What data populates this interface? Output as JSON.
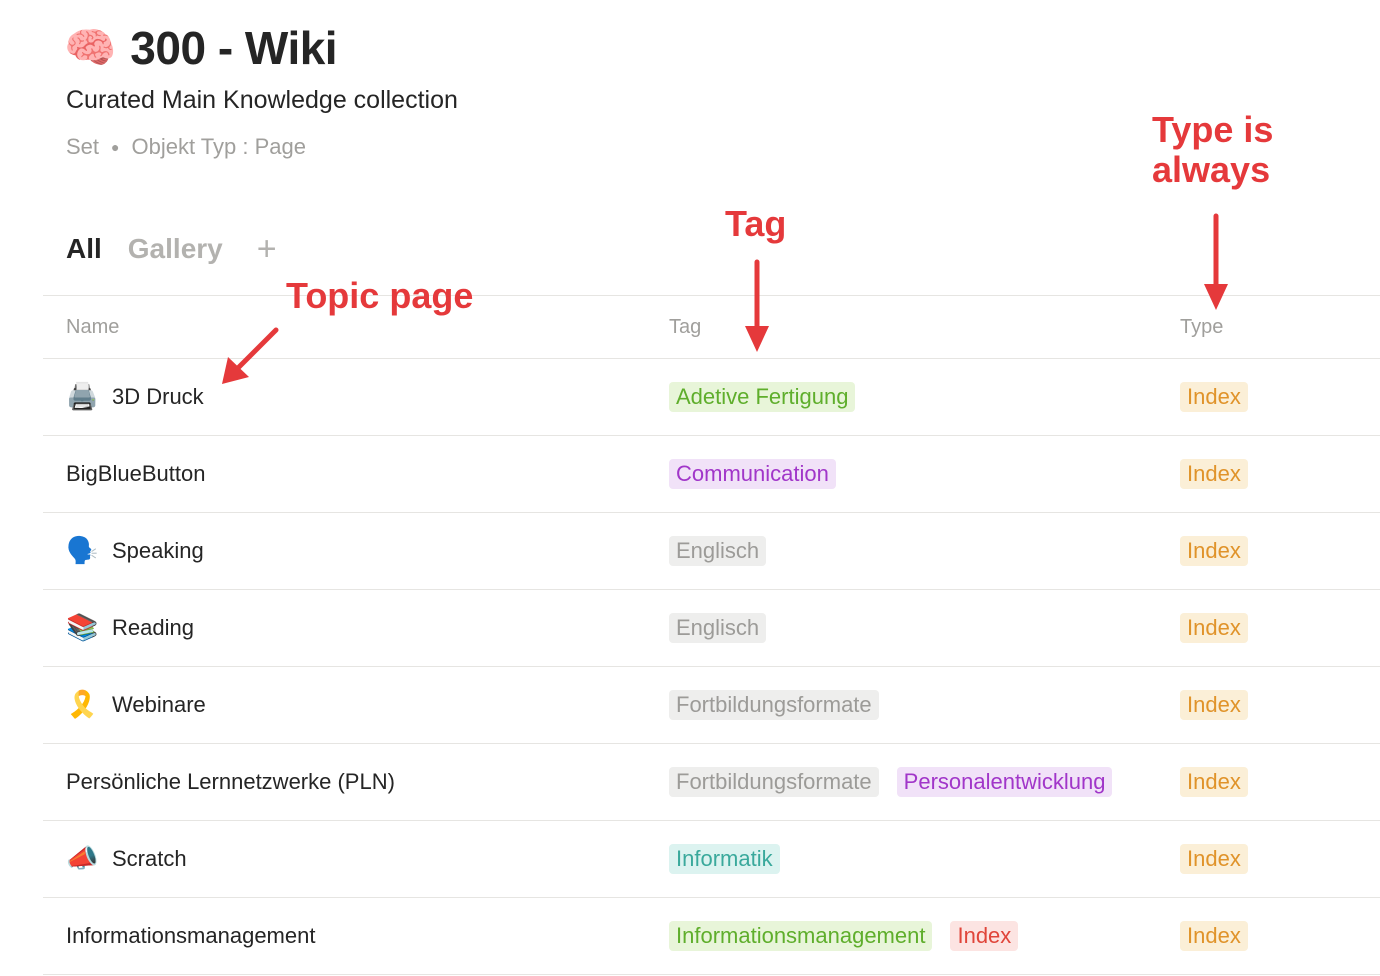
{
  "page": {
    "icon": "brain-icon",
    "icon_glyph": "🧠",
    "title": "300 - Wiki",
    "subtitle": "Curated Main Knowledge collection",
    "meta_set": "Set",
    "meta_type": "Objekt Typ : Page"
  },
  "tabs": {
    "all": "All",
    "gallery": "Gallery",
    "add": "+"
  },
  "table": {
    "headers": {
      "name": "Name",
      "tag": "Tag",
      "type": "Type"
    },
    "rows": [
      {
        "icon": "printer-icon",
        "glyph": "🖨️",
        "name": "3D Druck",
        "tags": [
          {
            "label": "Adetive Fertigung",
            "color": "#5fae2c",
            "bg": "#e8f5d9"
          }
        ],
        "type": {
          "label": "Index",
          "color": "#e0932a",
          "bg": "#fbefd7"
        }
      },
      {
        "icon": "",
        "glyph": "",
        "name": "BigBlueButton",
        "tags": [
          {
            "label": "Communication",
            "color": "#a136c9",
            "bg": "#f1e2f8"
          }
        ],
        "type": {
          "label": "Index",
          "color": "#e0932a",
          "bg": "#fbefd7"
        }
      },
      {
        "icon": "speaking-head-icon",
        "glyph": "🗣️",
        "name": "Speaking",
        "tags": [
          {
            "label": "Englisch",
            "color": "#9c9b98",
            "bg": "#eeeeed"
          }
        ],
        "type": {
          "label": "Index",
          "color": "#e0932a",
          "bg": "#fbefd7"
        }
      },
      {
        "icon": "books-icon",
        "glyph": "📚",
        "name": "Reading",
        "tags": [
          {
            "label": "Englisch",
            "color": "#9c9b98",
            "bg": "#eeeeed"
          }
        ],
        "type": {
          "label": "Index",
          "color": "#e0932a",
          "bg": "#fbefd7"
        }
      },
      {
        "icon": "ribbon-icon",
        "glyph": "🎗️",
        "name": "Webinare",
        "tags": [
          {
            "label": "Fortbildungsformate",
            "color": "#9c9b98",
            "bg": "#eeeeed"
          }
        ],
        "type": {
          "label": "Index",
          "color": "#e0932a",
          "bg": "#fbefd7"
        }
      },
      {
        "icon": "",
        "glyph": "",
        "name": "Persönliche Lernnetzwerke (PLN)",
        "tags": [
          {
            "label": "Fortbildungsformate",
            "color": "#9c9b98",
            "bg": "#eeeeed"
          },
          {
            "label": "Personalentwicklung",
            "color": "#a136c9",
            "bg": "#f1e2f8"
          }
        ],
        "type": {
          "label": "Index",
          "color": "#e0932a",
          "bg": "#fbefd7"
        }
      },
      {
        "icon": "megaphone-icon",
        "glyph": "📣",
        "name": "Scratch",
        "tags": [
          {
            "label": "Informatik",
            "color": "#3aa99c",
            "bg": "#dcf3f0"
          }
        ],
        "type": {
          "label": "Index",
          "color": "#e0932a",
          "bg": "#fbefd7"
        }
      },
      {
        "icon": "",
        "glyph": "",
        "name": "Informationsmanagement",
        "tags": [
          {
            "label": "Informationsmanagement",
            "color": "#5fae2c",
            "bg": "#e8f5d9"
          },
          {
            "label": "Index",
            "color": "#e0453a",
            "bg": "#fce4e2"
          }
        ],
        "type": {
          "label": "Index",
          "color": "#e0932a",
          "bg": "#fbefd7"
        }
      }
    ]
  },
  "annotations": {
    "topic_page": "Topic page",
    "tag": "Tag",
    "type_line1": "Type is",
    "type_line2": "always",
    "color": "#e5393b"
  }
}
